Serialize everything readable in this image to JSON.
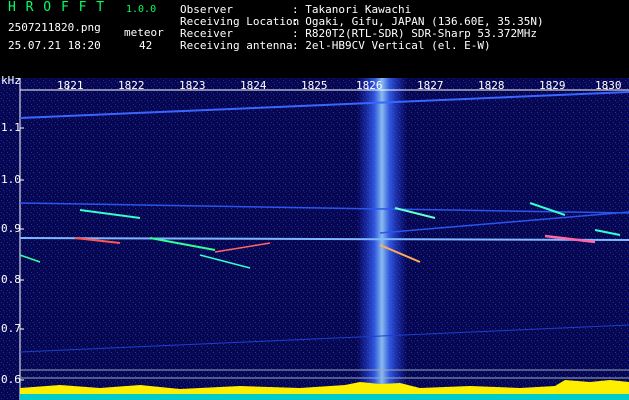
{
  "app": {
    "name": "H R O F F T",
    "version": "1.0.0"
  },
  "file": {
    "name": "2507211820.png",
    "datetime": "25.07.21 18:20"
  },
  "meteor": {
    "label": "meteor",
    "count": "42"
  },
  "info": [
    {
      "key": "Observer",
      "value": ": Takanori Kawachi"
    },
    {
      "key": "Receiving Location",
      "value": ": Ogaki, Gifu, JAPAN (136.60E, 35.35N)"
    },
    {
      "key": "Receiver",
      "value": ": R820T2(RTL-SDR) SDR-Sharp 53.372MHz"
    },
    {
      "key": "Receiving antenna",
      "value": ": 2el-HB9CV Vertical (el. E-W)"
    }
  ],
  "axis": {
    "unit": "kHz",
    "x_ticks": [
      "1821",
      "1822",
      "1823",
      "1824",
      "1825",
      "1826",
      "1827",
      "1828",
      "1829",
      "1830"
    ],
    "y_ticks": [
      "1.1",
      "1.0",
      "0.9",
      "0.8",
      "0.7",
      "0.6"
    ]
  },
  "colors": {
    "title_green": "#00ff66",
    "background_noise": "#0a0a6a",
    "axis_white": "#ffffff"
  }
}
